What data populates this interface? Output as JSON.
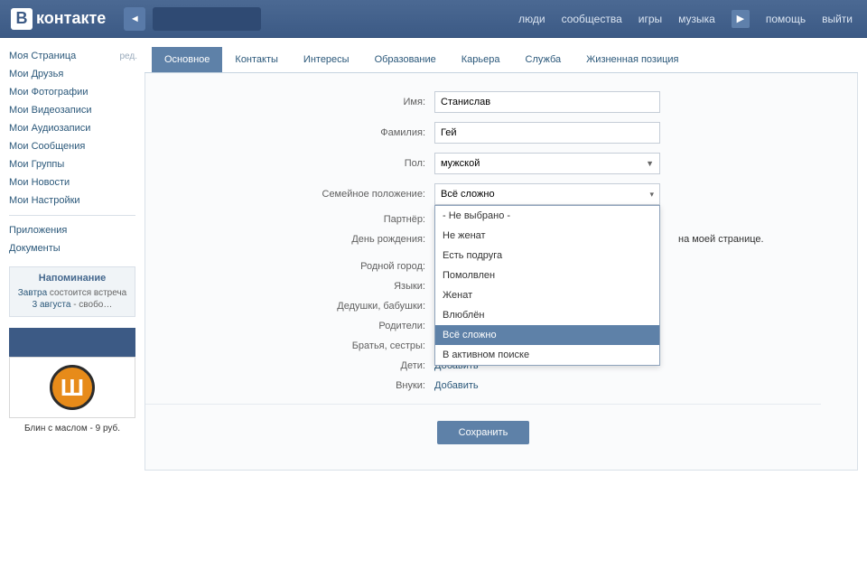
{
  "header": {
    "logo_letter": "В",
    "logo_text": "контакте",
    "nav": {
      "people": "люди",
      "communities": "сообщества",
      "games": "игры",
      "music": "музыка",
      "help": "помощь",
      "logout": "выйти"
    }
  },
  "sidebar": {
    "items": [
      "Моя Страница",
      "Мои Друзья",
      "Мои Фотографии",
      "Мои Видеозаписи",
      "Мои Аудиозаписи",
      "Мои Сообщения",
      "Мои Группы",
      "Мои Новости",
      "Мои Настройки"
    ],
    "edit": "ред.",
    "extra": [
      "Приложения",
      "Документы"
    ],
    "reminder": {
      "title": "Напоминание",
      "tomorrow": "Завтра",
      "text": " состоится встреча ",
      "date": "3 августа",
      "tail": " - свобо…"
    },
    "ad": {
      "glyph": "Ш",
      "text": "Блин с маслом - 9 руб."
    }
  },
  "tabs": [
    "Основное",
    "Контакты",
    "Интересы",
    "Образование",
    "Карьера",
    "Служба",
    "Жизненная позиция"
  ],
  "form": {
    "name_label": "Имя:",
    "name_value": "Станислав",
    "surname_label": "Фамилия:",
    "surname_value": "Гей",
    "gender_label": "Пол:",
    "gender_value": "мужской",
    "status_label": "Семейное положение:",
    "status_value": "Всё сложно",
    "status_options": [
      "- Не выбрано -",
      "Не женат",
      "Есть подруга",
      "Помолвлен",
      "Женат",
      "Влюблён",
      "Всё сложно",
      "В активном поиске"
    ],
    "partner_label": "Партнёр:",
    "birthday_label": "День рождения:",
    "page_note": "на моей странице.",
    "hometown_label": "Родной город:",
    "languages_label": "Языки:",
    "grandparents_label": "Дедушки, бабушки:",
    "parents_label": "Родители:",
    "siblings_label": "Братья, сестры:",
    "children_label": "Дети:",
    "grandchildren_label": "Внуки:",
    "add": "Добавить",
    "save": "Сохранить"
  }
}
